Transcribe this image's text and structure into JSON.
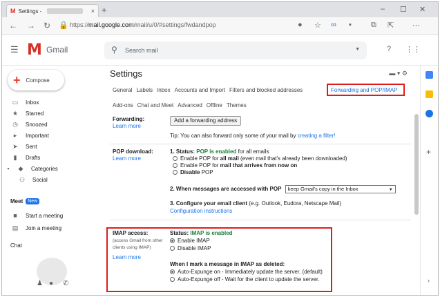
{
  "browser": {
    "tab_title": "Settings -",
    "tab_close": "×",
    "new_tab": "+",
    "window_controls": [
      "–",
      "☐",
      "✕"
    ],
    "url_prefix": "https://",
    "url_domain": "mail.google.com",
    "url_path": "/mail/u/0/#settings/fwdandpop"
  },
  "gmail": {
    "logo_letter": "M",
    "logo_text": "Gmail",
    "search_placeholder": "Search mail",
    "brand_red": "#d93025",
    "accent_blue": "#1a73e8"
  },
  "sidebar": {
    "compose": "Compose",
    "items": [
      {
        "icon": "inbox-icon",
        "label": "Inbox"
      },
      {
        "icon": "star-icon",
        "label": "Starred"
      },
      {
        "icon": "clock-icon",
        "label": "Snoozed"
      },
      {
        "icon": "important-icon",
        "label": "Important"
      },
      {
        "icon": "send-icon",
        "label": "Sent"
      },
      {
        "icon": "file-icon",
        "label": "Drafts"
      },
      {
        "icon": "label-icon",
        "label": "Categories"
      },
      {
        "icon": "people-icon",
        "label": "Social"
      }
    ],
    "meet_heading": "Meet",
    "meet_badge": "New",
    "meet_items": [
      {
        "icon": "video-icon",
        "label": "Start a meeting"
      },
      {
        "icon": "keyboard-icon",
        "label": "Join a meeting"
      }
    ],
    "chat_heading": "Chat"
  },
  "settings": {
    "title": "Settings",
    "tabs_row1": [
      "General",
      "Labels",
      "Inbox",
      "Accounts and Import",
      "Filters and blocked addresses"
    ],
    "active_tab": "Forwarding and POP/IMAP",
    "tabs_row2": [
      "Add-ons",
      "Chat and Meet",
      "Advanced",
      "Offline",
      "Themes"
    ],
    "forwarding": {
      "label": "Forwarding:",
      "learn_more": "Learn more",
      "button": "Add a forwarding address",
      "tip_prefix": "Tip: You can also forward only some of your mail by ",
      "tip_link": "creating a filter!"
    },
    "pop": {
      "label": "POP download:",
      "learn_more": "Learn more",
      "status_prefix": "1. Status: ",
      "status_value": "POP is enabled",
      "status_suffix": " for all emails",
      "opt1_prefix": "Enable POP for ",
      "opt1_bold": "all mail",
      "opt1_suffix": " (even mail that's already been downloaded)",
      "opt2_prefix": "Enable POP for ",
      "opt2_bold": "mail that arrives from now on",
      "opt3_prefix": "",
      "opt3_bold": "Disable",
      "opt3_suffix": " POP",
      "step2": "2. When messages are accessed with POP",
      "step2_select": "keep Gmail's copy in the Inbox",
      "step3_bold": "3. Configure your email client",
      "step3_rest": " (e.g. Outlook, Eudora, Netscape Mail)",
      "step3_link": "Configuration instructions"
    },
    "imap": {
      "label": "IMAP access:",
      "note_line1": "(access Gmail from other",
      "note_line2": "clients using IMAP)",
      "learn_more": "Learn more",
      "status_prefix": "Status: ",
      "status_value": "IMAP is enabled",
      "opt_enable": "Enable IMAP",
      "opt_disable": "Disable IMAP",
      "deleted_heading": "When I mark a message in IMAP as deleted:",
      "opt_auto_on": "Auto-Expunge on - Immediately update the server. (default)",
      "opt_auto_off": "Auto-Expunge off - Wait for the client to update the server."
    }
  }
}
